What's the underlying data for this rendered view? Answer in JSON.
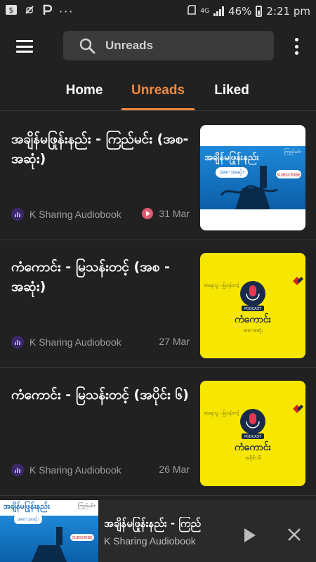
{
  "status_bar": {
    "time": "2:21 pm",
    "battery": "46%",
    "network": "4G",
    "icons": [
      "dollar-icon",
      "muted-notification-icon",
      "p-icon",
      "more-dots-icon",
      "sd-card-icon",
      "signal-icon",
      "battery-icon"
    ]
  },
  "header": {
    "menu_icon": "hamburger-menu-icon",
    "search_placeholder": "Unreads",
    "more_icon": "vertical-dots-icon"
  },
  "tabs": [
    {
      "label": "Home",
      "active": false
    },
    {
      "label": "Unreads",
      "active": true
    },
    {
      "label": "Liked",
      "active": false
    }
  ],
  "accent_color": "#f0883e",
  "items": [
    {
      "title": "အချိန်မဖြုန်းနည်း - ကြည်မင်း (အစ-အဆုံး)",
      "source": "K Sharing Audiobook",
      "date": "31 Mar",
      "playing": true,
      "thumb_style": "blue",
      "thumb_title": "အချိန်မဖြုန်းနည်း",
      "thumb_sub": "အစ-အဆုံး",
      "thumb_author": "ကြည်မင်း",
      "thumb_badge": "SUBSCRIBE"
    },
    {
      "title": "ကံကောင်း - မြသန်းတင့် (အစ - အဆုံး)",
      "source": "K Sharing Audiobook",
      "date": "27 Mar",
      "playing": false,
      "thumb_style": "yellow",
      "thumb_title": "ကံကောင်း",
      "thumb_sub": "အစ-အဆုံး",
      "thumb_header": "စာရေးသူ - မြသန်းတင့်",
      "thumb_badge": "PODCAST"
    },
    {
      "title": "ကံကောင်း - မြသန်းတင့် (အပိုင်း ၆)",
      "source": "K Sharing Audiobook",
      "date": "26 Mar",
      "playing": false,
      "thumb_style": "yellow",
      "thumb_title": "ကံကောင်း",
      "thumb_sub": "အပိုင်း ၆",
      "thumb_header": "စာရေးသူ - မြသန်းတင့်",
      "thumb_badge": "PODCAST"
    }
  ],
  "player": {
    "title": "အချိန်မဖြုန်းနည်း - ကြည်",
    "subtitle": "K Sharing Audiobook",
    "thumb_title": "အချိန်မဖြုန်းနည်း",
    "thumb_sub": "အစ-အဆုံး",
    "thumb_author": "ကြည်မင်း",
    "thumb_badge": "SUBSCRIBE",
    "play_icon": "play-icon",
    "close_icon": "close-icon"
  }
}
